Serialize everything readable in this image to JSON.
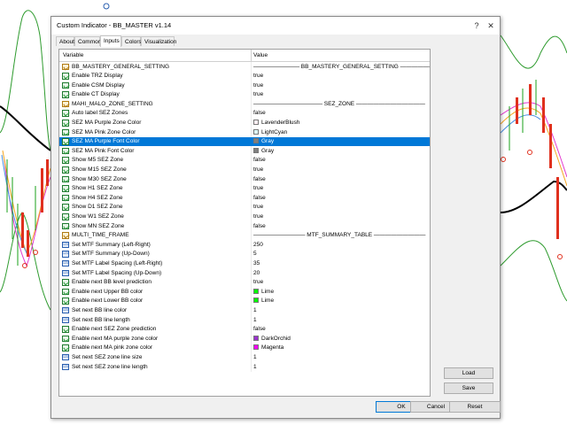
{
  "window": {
    "title": "Custom Indicator - BB_MASTER v1.14",
    "help_glyph": "?",
    "close_glyph": "✕"
  },
  "tabs": [
    {
      "label": "About"
    },
    {
      "label": "Common"
    },
    {
      "label": "Inputs"
    },
    {
      "label": "Colors"
    },
    {
      "label": "Visualization"
    }
  ],
  "table": {
    "col_variable": "Variable",
    "col_value": "Value",
    "rows": [
      {
        "variable": "BB_MASTERY_GENERAL_SETTING",
        "value": "———————— BB_MASTERY_GENERAL_SETTING ————————",
        "icon": "title",
        "swatch": ""
      },
      {
        "variable": "Enable TRZ Display",
        "value": "true",
        "icon": "bool",
        "swatch": ""
      },
      {
        "variable": "Enable CSM Display",
        "value": "true",
        "icon": "bool",
        "swatch": ""
      },
      {
        "variable": "Enable CT Display",
        "value": "true",
        "icon": "bool",
        "swatch": ""
      },
      {
        "variable": "MAHI_MALO_ZONE_SETTING",
        "value": "———————————— SEZ_ZONE ————————————",
        "icon": "title",
        "swatch": ""
      },
      {
        "variable": "Auto label SEZ Zones",
        "value": "false",
        "icon": "bool",
        "swatch": ""
      },
      {
        "variable": "SEZ MA Purple Zone Color",
        "value": "LavenderBlush",
        "icon": "bool",
        "swatch": "#fff0f5"
      },
      {
        "variable": "SEZ MA Pink Zone Color",
        "value": "LightCyan",
        "icon": "bool",
        "swatch": "#e0ffff"
      },
      {
        "variable": "SEZ MA Purple Font Color",
        "value": "Gray",
        "icon": "bool",
        "swatch": "#808080"
      },
      {
        "variable": "SEZ MA Pink Font Color",
        "value": "Gray",
        "icon": "bool",
        "swatch": "#808080"
      },
      {
        "variable": "Show M5 SEZ Zone",
        "value": "false",
        "icon": "bool",
        "swatch": ""
      },
      {
        "variable": "Show M15 SEZ Zone",
        "value": "true",
        "icon": "bool",
        "swatch": ""
      },
      {
        "variable": "Show M30 SEZ Zone",
        "value": "false",
        "icon": "bool",
        "swatch": ""
      },
      {
        "variable": "Show H1 SEZ Zone",
        "value": "true",
        "icon": "bool",
        "swatch": ""
      },
      {
        "variable": "Show H4 SEZ Zone",
        "value": "false",
        "icon": "bool",
        "swatch": ""
      },
      {
        "variable": "Show D1 SEZ Zone",
        "value": "true",
        "icon": "bool",
        "swatch": ""
      },
      {
        "variable": "Show W1 SEZ Zone",
        "value": "true",
        "icon": "bool",
        "swatch": ""
      },
      {
        "variable": "Show MN SEZ Zone",
        "value": "false",
        "icon": "bool",
        "swatch": ""
      },
      {
        "variable": "MULTI_TIME_FRAME",
        "value": "————————— MTF_SUMMARY_TABLE —————————",
        "icon": "title",
        "swatch": ""
      },
      {
        "variable": "Set MTF Summary (Left-Right)",
        "value": "250",
        "icon": "num",
        "swatch": ""
      },
      {
        "variable": "Set MTF Summary (Up-Down)",
        "value": "5",
        "icon": "num",
        "swatch": ""
      },
      {
        "variable": "Set MTF Label Spacing (Left-Right)",
        "value": "35",
        "icon": "num",
        "swatch": ""
      },
      {
        "variable": "Set MTF Label Spacing (Up-Down)",
        "value": "20",
        "icon": "num",
        "swatch": ""
      },
      {
        "variable": "Enable next BB level prediction",
        "value": "true",
        "icon": "bool",
        "swatch": ""
      },
      {
        "variable": "Enable next Upper BB color",
        "value": "Lime",
        "icon": "bool",
        "swatch": "#00ff00"
      },
      {
        "variable": "Enable next Lower BB color",
        "value": "Lime",
        "icon": "bool",
        "swatch": "#00ff00"
      },
      {
        "variable": "Set next BB line color",
        "value": "1",
        "icon": "num",
        "swatch": ""
      },
      {
        "variable": "Set next BB line length",
        "value": "1",
        "icon": "num",
        "swatch": ""
      },
      {
        "variable": "Enable next SEZ Zone prediction",
        "value": "false",
        "icon": "bool",
        "swatch": ""
      },
      {
        "variable": "Enable next MA purple zone color",
        "value": "DarkOrchid",
        "icon": "bool",
        "swatch": "#9932cc"
      },
      {
        "variable": "Enable next MA pink zone color",
        "value": "Magenta",
        "icon": "bool",
        "swatch": "#ff00ff"
      },
      {
        "variable": "Set next SEZ zone line size",
        "value": "1",
        "icon": "num",
        "swatch": ""
      },
      {
        "variable": "Set next SEZ zone line length",
        "value": "1",
        "icon": "num",
        "swatch": ""
      }
    ],
    "selected_index": 8
  },
  "buttons": {
    "load": "Load",
    "save": "Save",
    "ok": "OK",
    "cancel": "Cancel",
    "reset": "Reset"
  },
  "colors": {
    "selection": "#0078d7",
    "band_line": "#2e9b2e",
    "ma_line": "#000000"
  }
}
